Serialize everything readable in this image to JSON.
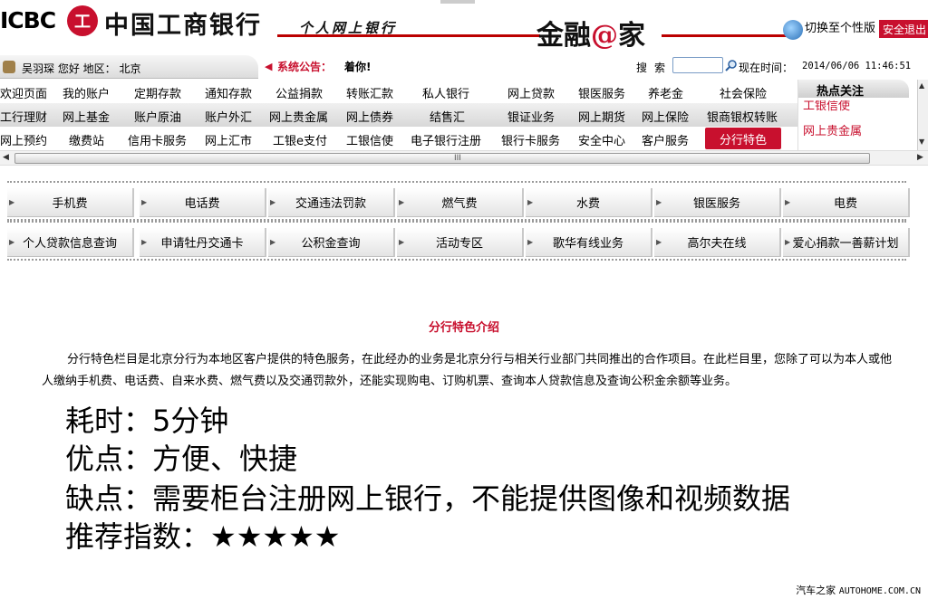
{
  "header": {
    "logo_text": "ICBC",
    "emblem_glyph": "工",
    "bank_name": "中国工商银行",
    "personal_banking": "个人网上银行",
    "slogan_prefix": "金融",
    "slogan_at": "@",
    "slogan_suffix": "家",
    "switch_label": "切换至个性版",
    "safety_label": "安全退出"
  },
  "infobar": {
    "user_text": "吴羽琛  您好  地区：  北京",
    "notice_label": "系统公告：",
    "notice_text": "着你!",
    "search_label": "搜索",
    "search_value": "",
    "time_label": "现在时间：",
    "time_value": "2014/06/06 11:46:51"
  },
  "menu": {
    "row1": [
      "欢迎页面",
      "我的账户",
      "定期存款",
      "通知存款",
      "公益捐款",
      "转账汇款",
      "私人银行",
      "网上贷款",
      "银医服务",
      "养老金",
      "社会保险"
    ],
    "row2": [
      "工行理财",
      "网上基金",
      "账户原油",
      "账户外汇",
      "网上贵金属",
      "网上债券",
      "结售汇",
      "银证业务",
      "网上期货",
      "网上保险",
      "银商银权转账"
    ],
    "row3": [
      "网上预约",
      "缴费站",
      "信用卡服务",
      "网上汇市",
      "工银e支付",
      "工银信使",
      "电子银行注册",
      "银行卡服务",
      "安全中心",
      "客户服务",
      "分行特色"
    ]
  },
  "hot": {
    "title": "热点关注",
    "items": [
      "工银信使",
      "网上贵金属"
    ]
  },
  "scrollbar": {
    "grip": "III"
  },
  "services": {
    "row1": [
      "手机费",
      "电话费",
      "交通违法罚款",
      "燃气费",
      "水费",
      "银医服务",
      "电费"
    ],
    "row2": [
      "个人贷款信息查询",
      "申请牡丹交通卡",
      "公积金查询",
      "活动专区",
      "歌华有线业务",
      "高尔夫在线",
      "爱心捐款一善薪计划"
    ]
  },
  "intro": {
    "title": "分行特色介绍",
    "body": "分行特色栏目是北京分行为本地区客户提供的特色服务，在此经办的业务是北京分行与相关行业部门共同推出的合作项目。在此栏目里，您除了可以为本人或他人缴纳手机费、电话费、自来水费、燃气费以及交通罚款外，还能实现购电、订购机票、查询本人贷款信息及查询公积金余额等业务。"
  },
  "overlay": {
    "line1": "耗时：5分钟",
    "line2": "优点：方便、快捷",
    "line3": "缺点：需要柜台注册网上银行，不能提供图像和视频数据",
    "line4": "推荐指数：★★★★★"
  },
  "watermark": {
    "site_name": "汽车之家",
    "site_url": "AUTOHOME.COM.CN"
  },
  "colors": {
    "brand_red": "#c8102e",
    "menu_gray": "#d8d8d8"
  },
  "icons": [
    "user-icon",
    "notice-icon",
    "search-icon",
    "switch-icon",
    "arrow-left-icon",
    "arrow-right-icon",
    "arrow-up-icon",
    "arrow-down-icon"
  ]
}
